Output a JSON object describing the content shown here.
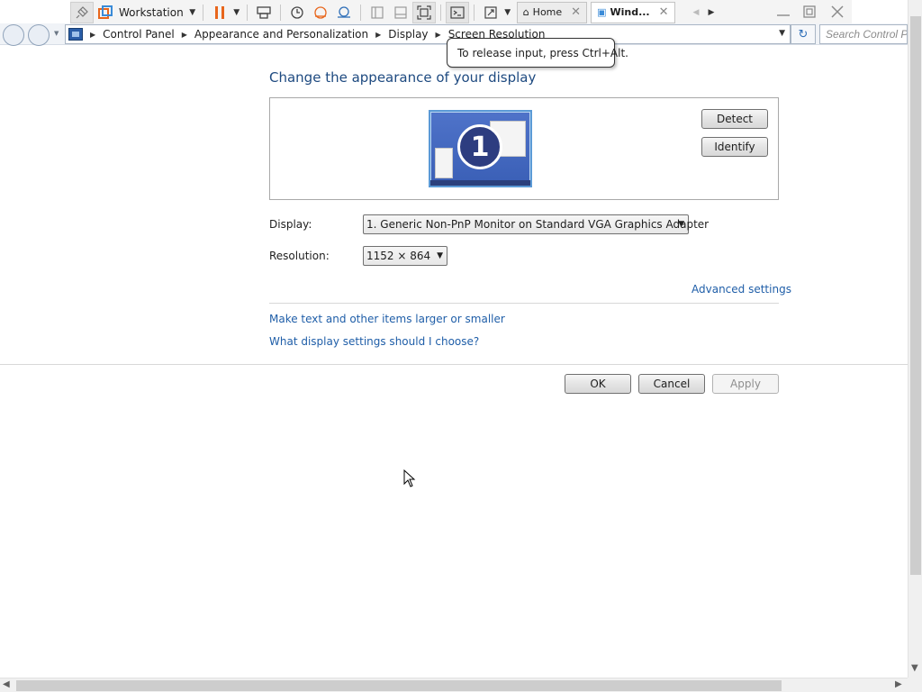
{
  "vm_toolbar": {
    "workstation_label": "Workstation",
    "tabs": [
      {
        "label": "Home"
      },
      {
        "label": "Wind..."
      }
    ]
  },
  "address_bar": {
    "breadcrumbs": [
      "Control Panel",
      "Appearance and Personalization",
      "Display",
      "Screen Resolution"
    ],
    "search_placeholder": "Search Control Pa"
  },
  "tooltip": {
    "text": "To release input, press Ctrl+Alt."
  },
  "main": {
    "title": "Change the appearance of your display",
    "monitor_number": "1",
    "detect_label": "Detect",
    "identify_label": "Identify",
    "display_label": "Display:",
    "display_value": "1. Generic Non-PnP Monitor on Standard VGA Graphics Adapter",
    "resolution_label": "Resolution:",
    "resolution_value": "1152 × 864",
    "advanced_link": "Advanced settings",
    "links": [
      "Make text and other items larger or smaller",
      "What display settings should I choose?"
    ],
    "ok_label": "OK",
    "cancel_label": "Cancel",
    "apply_label": "Apply"
  },
  "colors": {
    "title": "#1e4a80",
    "link": "#1f5ea8",
    "pause_icon": "#e8661c"
  }
}
